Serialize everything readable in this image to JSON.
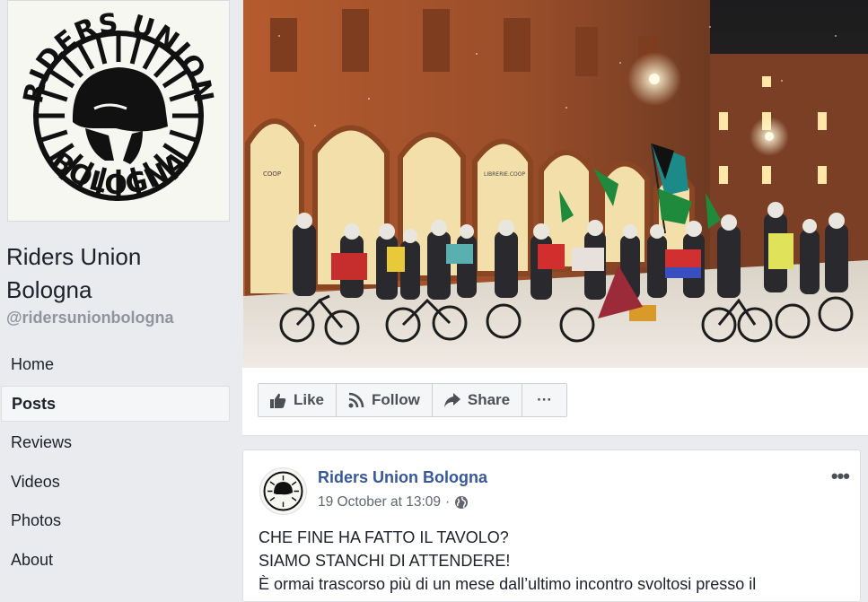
{
  "page": {
    "name": "Riders Union Bologna",
    "handle": "@ridersunionbologna",
    "logo_text_top": "RIDERS UNION",
    "logo_text_bottom": "BOLOGNA"
  },
  "nav": [
    {
      "label": "Home",
      "active": false
    },
    {
      "label": "Posts",
      "active": true
    },
    {
      "label": "Reviews",
      "active": false
    },
    {
      "label": "Videos",
      "active": false
    },
    {
      "label": "Photos",
      "active": false
    },
    {
      "label": "About",
      "active": false
    }
  ],
  "actions": {
    "like": "Like",
    "follow": "Follow",
    "share": "Share",
    "more": "···"
  },
  "cover": {
    "shop_sign_1": "COOP",
    "shop_sign_2": "LIBRERIE.COOP"
  },
  "post": {
    "author": "Riders Union Bologna",
    "timestamp": "19 October at 13:09",
    "separator": "·",
    "more": "•••",
    "lines": [
      "CHE FINE HA FATTO IL TAVOLO?",
      "SIAMO STANCHI DI ATTENDERE!",
      "È ormai trascorso più di un mese dall’ultimo incontro svoltosi presso il"
    ]
  },
  "colors": {
    "background": "#e9ebee",
    "link": "#365899",
    "text": "#1d2129",
    "muted": "#90949c"
  }
}
